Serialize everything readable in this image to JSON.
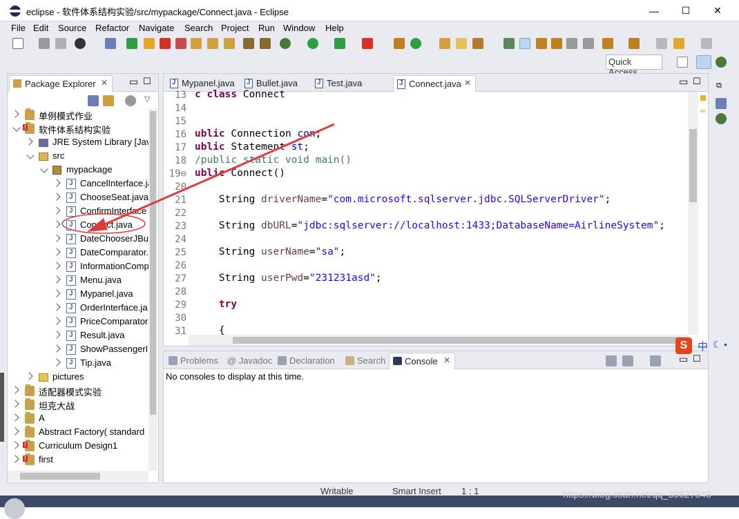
{
  "window": {
    "title": "eclipse - 软件体系结构实验/src/mypackage/Connect.java - Eclipse",
    "minimize": "—",
    "maximize": "☐",
    "close": "✕"
  },
  "menu": [
    "File",
    "Edit",
    "Source",
    "Refactor",
    "Navigate",
    "Search",
    "Project",
    "Run",
    "Window",
    "Help"
  ],
  "toolbar": {
    "quick_access": "Quick Access"
  },
  "package_explorer": {
    "title": "Package Explorer",
    "items": [
      {
        "label": "单例模式作业",
        "depth": 0,
        "state": "closed",
        "icon": "project"
      },
      {
        "label": "软件体系结构实验",
        "depth": 0,
        "state": "open",
        "icon": "project-error"
      },
      {
        "label": "JRE System Library [Java",
        "depth": 1,
        "state": "closed",
        "icon": "library"
      },
      {
        "label": "src",
        "depth": 1,
        "state": "open",
        "icon": "source-folder"
      },
      {
        "label": "mypackage",
        "depth": 2,
        "state": "open",
        "icon": "package"
      },
      {
        "label": "CancelInterface.ja",
        "depth": 3,
        "state": "closed",
        "icon": "java"
      },
      {
        "label": "ChooseSeat.java",
        "depth": 3,
        "state": "closed",
        "icon": "java"
      },
      {
        "label": "ConfirmInterface",
        "depth": 3,
        "state": "closed",
        "icon": "java"
      },
      {
        "label": "Connect.java",
        "depth": 3,
        "state": "closed",
        "icon": "java"
      },
      {
        "label": "DateChooserJBut",
        "depth": 3,
        "state": "closed",
        "icon": "java"
      },
      {
        "label": "DateComparator.",
        "depth": 3,
        "state": "closed",
        "icon": "java"
      },
      {
        "label": "InformationComp",
        "depth": 3,
        "state": "closed",
        "icon": "java"
      },
      {
        "label": "Menu.java",
        "depth": 3,
        "state": "closed",
        "icon": "java"
      },
      {
        "label": "Mypanel.java",
        "depth": 3,
        "state": "closed",
        "icon": "java"
      },
      {
        "label": "OrderInterface.ja",
        "depth": 3,
        "state": "closed",
        "icon": "java"
      },
      {
        "label": "PriceComparator.",
        "depth": 3,
        "state": "closed",
        "icon": "java"
      },
      {
        "label": "Result.java",
        "depth": 3,
        "state": "closed",
        "icon": "java"
      },
      {
        "label": "ShowPassengerIr",
        "depth": 3,
        "state": "closed",
        "icon": "java"
      },
      {
        "label": "Tip.java",
        "depth": 3,
        "state": "closed",
        "icon": "java"
      },
      {
        "label": "pictures",
        "depth": 1,
        "state": "closed",
        "icon": "folder"
      },
      {
        "label": "适配器模式实验",
        "depth": 0,
        "state": "closed",
        "icon": "project"
      },
      {
        "label": "坦克大战",
        "depth": 0,
        "state": "closed",
        "icon": "project"
      },
      {
        "label": "A",
        "depth": 0,
        "state": "closed",
        "icon": "project"
      },
      {
        "label": "Abstract Factory( standard",
        "depth": 0,
        "state": "closed",
        "icon": "project"
      },
      {
        "label": "Curriculum Design1",
        "depth": 0,
        "state": "closed",
        "icon": "project-error"
      },
      {
        "label": "first",
        "depth": 0,
        "state": "closed",
        "icon": "project-error"
      }
    ]
  },
  "editor": {
    "tabs": [
      "Mypanel.java",
      "Bullet.java",
      "Test.java",
      "Connect.java"
    ],
    "active_tab": "Connect.java",
    "lines": [
      {
        "n": "13",
        "code": [
          [
            "kw",
            "c class "
          ],
          [
            "plain",
            "Connect"
          ]
        ]
      },
      {
        "n": "14",
        "code": []
      },
      {
        "n": "15",
        "code": []
      },
      {
        "n": "16",
        "code": [
          [
            "kw",
            "ublic "
          ],
          [
            "plain",
            "Connection "
          ],
          [
            "fld",
            "con"
          ],
          [
            "plain",
            ";"
          ]
        ]
      },
      {
        "n": "17",
        "code": [
          [
            "kw",
            "ublic "
          ],
          [
            "plain",
            "Statement "
          ],
          [
            "fld",
            "st"
          ],
          [
            "plain",
            ";"
          ]
        ]
      },
      {
        "n": "18",
        "code": [
          [
            "cmt",
            "/public static void main()"
          ]
        ]
      },
      {
        "n": "19⊖",
        "code": [
          [
            "kw",
            "ublic "
          ],
          [
            "plain",
            "Connect()"
          ]
        ]
      },
      {
        "n": "20",
        "code": []
      },
      {
        "n": "21",
        "code": [
          [
            "plain",
            "    String "
          ],
          [
            "var",
            "driverName"
          ],
          [
            "plain",
            "="
          ],
          [
            "str",
            "\"com.microsoft.sqlserver.jdbc.SQLServerDriver\""
          ],
          [
            "plain",
            ";"
          ]
        ]
      },
      {
        "n": "22",
        "code": []
      },
      {
        "n": "23",
        "code": [
          [
            "plain",
            "    String "
          ],
          [
            "var",
            "dbURL"
          ],
          [
            "plain",
            "="
          ],
          [
            "str",
            "\"jdbc:sqlserver://localhost:1433;DatabaseName=AirlineSystem\""
          ],
          [
            "plain",
            ";"
          ]
        ]
      },
      {
        "n": "24",
        "code": []
      },
      {
        "n": "25",
        "code": [
          [
            "plain",
            "    String "
          ],
          [
            "var",
            "userName"
          ],
          [
            "plain",
            "="
          ],
          [
            "str",
            "\"sa\""
          ],
          [
            "plain",
            ";"
          ]
        ]
      },
      {
        "n": "26",
        "code": []
      },
      {
        "n": "27",
        "code": [
          [
            "plain",
            "    String "
          ],
          [
            "var",
            "userPwd"
          ],
          [
            "plain",
            "="
          ],
          [
            "str",
            "\"231231asd\""
          ],
          [
            "plain",
            ";"
          ]
        ]
      },
      {
        "n": "28",
        "code": []
      },
      {
        "n": "29",
        "code": [
          [
            "plain",
            "    "
          ],
          [
            "kw",
            "try"
          ]
        ]
      },
      {
        "n": "30",
        "code": []
      },
      {
        "n": "31",
        "code": [
          [
            "plain",
            "    {"
          ]
        ]
      }
    ]
  },
  "console_panel": {
    "tabs": [
      "Problems",
      "@ Javadoc",
      "Declaration",
      "Search",
      "Console"
    ],
    "active_tab": "Console",
    "message": "No consoles to display at this time."
  },
  "status_bar": {
    "writable": "Writable",
    "insert_mode": "Smart Insert",
    "position": "1 : 1",
    "watermark": "https://blog.csdn.net/qq_39627843"
  },
  "ime": {
    "logo": "S",
    "lang": "中"
  }
}
